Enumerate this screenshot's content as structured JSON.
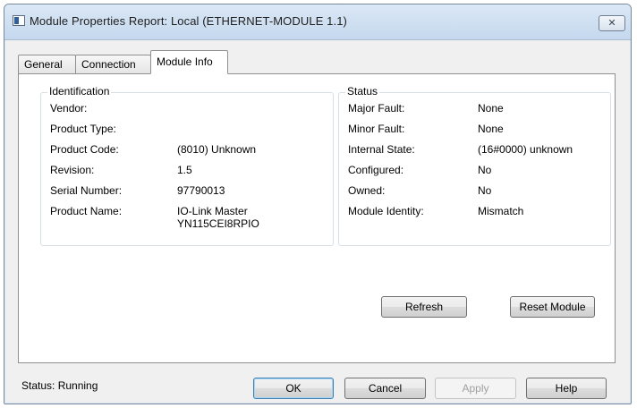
{
  "window": {
    "title": "Module Properties Report: Local (ETHERNET-MODULE 1.1)",
    "close_glyph": "✕"
  },
  "tabs": [
    {
      "label": "General",
      "active": false
    },
    {
      "label": "Connection",
      "active": false
    },
    {
      "label": "Module Info",
      "active": true
    }
  ],
  "identification": {
    "title": "Identification",
    "rows": [
      {
        "label": "Vendor:",
        "value": ""
      },
      {
        "label": "Product Type:",
        "value": ""
      },
      {
        "label": "Product Code:",
        "value": "(8010) Unknown"
      },
      {
        "label": "Revision:",
        "value": "1.5"
      },
      {
        "label": "Serial Number:",
        "value": "97790013"
      },
      {
        "label": "Product Name:",
        "value": "IO-Link Master",
        "value2": "YN115CEI8RPIO"
      }
    ]
  },
  "status_group": {
    "title": "Status",
    "rows": [
      {
        "label": "Major Fault:",
        "value": "None"
      },
      {
        "label": "Minor Fault:",
        "value": "None"
      },
      {
        "label": "Internal State:",
        "value": "(16#0000) unknown"
      },
      {
        "label": "Configured:",
        "value": "No"
      },
      {
        "label": "Owned:",
        "value": "No"
      },
      {
        "label": "Module Identity:",
        "value": "Mismatch"
      }
    ]
  },
  "panel_buttons": {
    "refresh": "Refresh",
    "reset_module": "Reset Module"
  },
  "footer": {
    "status": "Status:  Running",
    "ok": "OK",
    "cancel": "Cancel",
    "apply": "Apply",
    "help": "Help"
  },
  "colors": {
    "titlebar": "#c5d8ee",
    "dialog_bg": "#f0f0f0",
    "default_button_border": "#3c7fb1"
  }
}
